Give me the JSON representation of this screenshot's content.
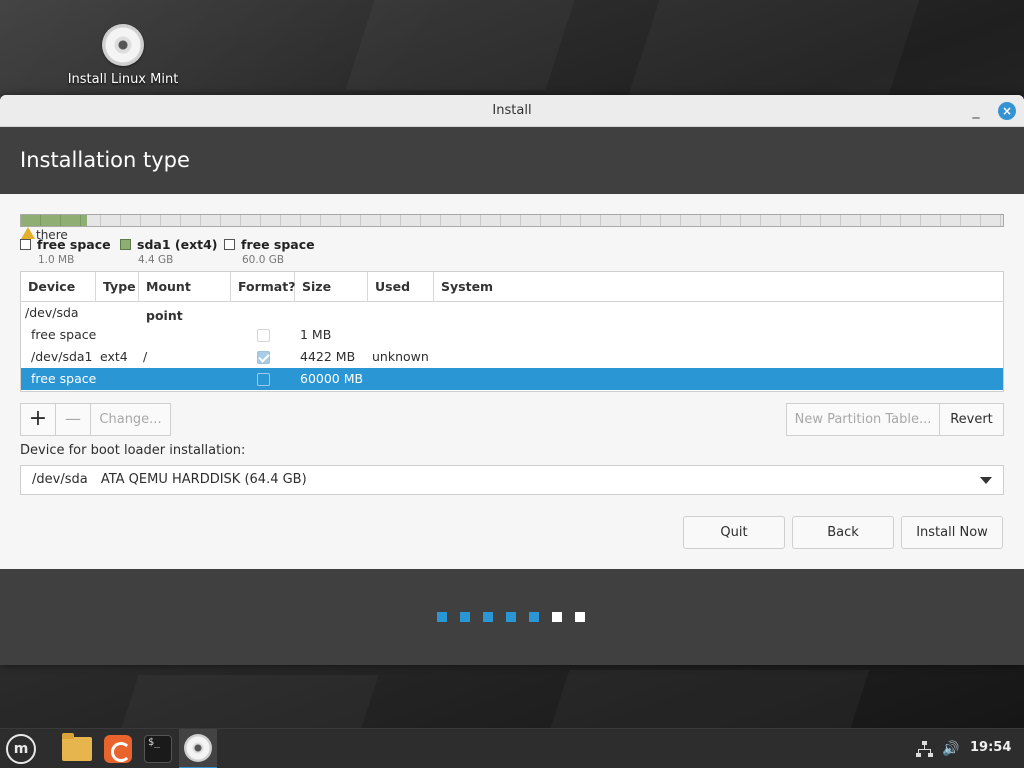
{
  "desktop": {
    "icon_label": "Install Linux Mint"
  },
  "window": {
    "title": "Install",
    "minimize_glyph": "_",
    "close_glyph": "×",
    "header": "Installation type"
  },
  "partition_bar": {
    "warning_text": "there",
    "legend": [
      {
        "name": "free space",
        "size": "1.0 MB",
        "color": "#ffffff"
      },
      {
        "name": "sda1 (ext4)",
        "size": "4.4 GB",
        "color": "#8fae74"
      },
      {
        "name": "free space",
        "size": "60.0 GB",
        "color": "#ffffff"
      }
    ]
  },
  "table": {
    "columns": [
      "Device",
      "Type",
      "Mount point",
      "Format?",
      "Size",
      "Used",
      "System"
    ],
    "rows": [
      {
        "device": "/dev/sda",
        "type": "",
        "mount": "",
        "format": null,
        "size": "",
        "used": "",
        "system": ""
      },
      {
        "device": "free space",
        "type": "",
        "mount": "",
        "format": false,
        "size": "1 MB",
        "used": "",
        "system": ""
      },
      {
        "device": "/dev/sda1",
        "type": "ext4",
        "mount": "/",
        "format": true,
        "size": "4422 MB",
        "used": "unknown",
        "system": ""
      },
      {
        "device": "free space",
        "type": "",
        "mount": "",
        "format": false,
        "size": "60000 MB",
        "used": "",
        "system": "",
        "selected": true
      }
    ]
  },
  "toolbar": {
    "add_glyph": "+",
    "remove_glyph": "—",
    "change_label": "Change...",
    "new_table_label": "New Partition Table...",
    "revert_label": "Revert"
  },
  "bootloader": {
    "label": "Device for boot loader installation:",
    "device": "/dev/sda",
    "description": "ATA QEMU HARDDISK (64.4 GB)"
  },
  "actions": {
    "quit": "Quit",
    "back": "Back",
    "install": "Install Now"
  },
  "progress": {
    "total_steps": 7,
    "completed_steps": 5,
    "active_color": "#2b96d4",
    "inactive_color": "#ffffff"
  },
  "taskbar": {
    "menu_icon": "mint-menu-icon",
    "terminal_text": "$_",
    "clock": "19:54"
  }
}
